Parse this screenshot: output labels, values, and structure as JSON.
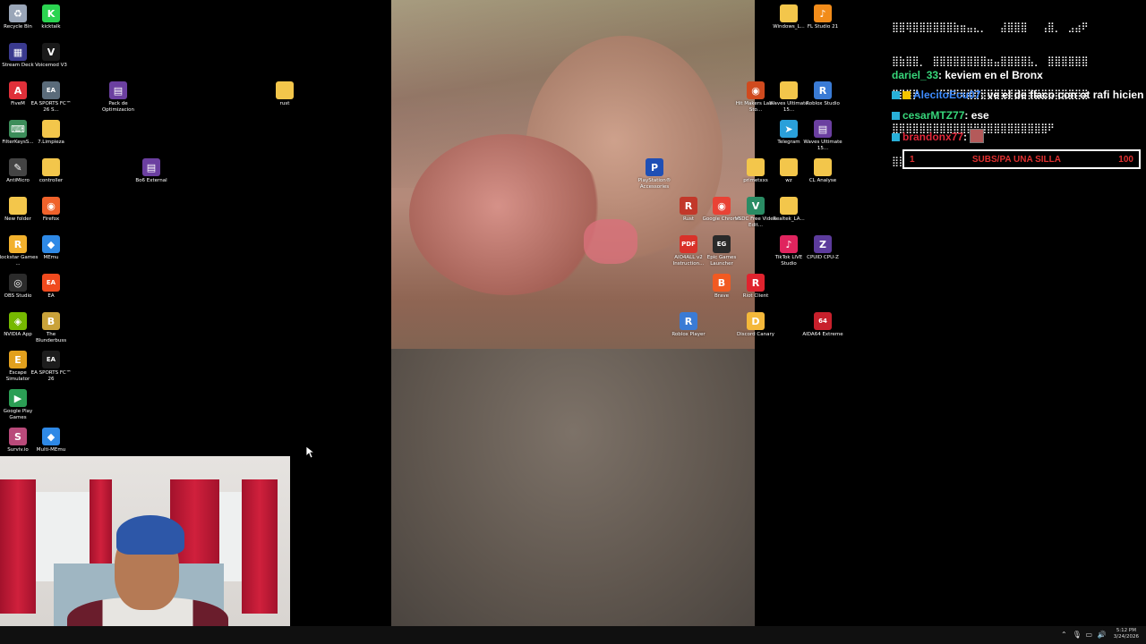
{
  "desktop": {
    "icons": [
      {
        "label": "Recycle Bin",
        "color": "#9aa6b8",
        "glyph": "♻"
      },
      {
        "label": "kicktalk",
        "color": "#2bd451",
        "glyph": "K"
      },
      {
        "label": "Stream Deck",
        "color": "#3a3a8f",
        "glyph": "▦"
      },
      {
        "label": "Voicemod V3",
        "color": "#1a1a1a",
        "glyph": "V"
      },
      {
        "label": "FiveM",
        "color": "#e0303a",
        "glyph": "A"
      },
      {
        "label": "EA SPORTS FC™ 26 S...",
        "color": "#5a6b7a",
        "glyph": "EA"
      },
      {
        "label": "Pack de Optimizacion",
        "color": "#6b3fa0",
        "glyph": "▤"
      },
      {
        "label": "rust",
        "color": "#f3c64b",
        "glyph": ""
      },
      {
        "label": "FilterKeysS...",
        "color": "#3c8d5a",
        "glyph": "⌨"
      },
      {
        "label": "7.Limpieza",
        "color": "#f3c64b",
        "glyph": ""
      },
      {
        "label": "AntiMicro",
        "color": "#444",
        "glyph": "✎"
      },
      {
        "label": "controller",
        "color": "#f3c64b",
        "glyph": ""
      },
      {
        "label": "Bo6 External",
        "color": "#6b3fa0",
        "glyph": "▤"
      },
      {
        "label": "New folder",
        "color": "#f3c64b",
        "glyph": ""
      },
      {
        "label": "Firefox",
        "color": "#f0622b",
        "glyph": "◉"
      },
      {
        "label": "Rockstar Games ...",
        "color": "#f2b12d",
        "glyph": "R"
      },
      {
        "label": "MEmu",
        "color": "#2e89e6",
        "glyph": "◆"
      },
      {
        "label": "OBS Studio",
        "color": "#2b2b2b",
        "glyph": "◎"
      },
      {
        "label": "EA",
        "color": "#f04a1e",
        "glyph": "EA"
      },
      {
        "label": "NVIDIA App",
        "color": "#76b900",
        "glyph": "◈"
      },
      {
        "label": "The Blunderbuss",
        "color": "#c9a23a",
        "glyph": "B"
      },
      {
        "label": "Escape Simulator",
        "color": "#e2a01d",
        "glyph": "E"
      },
      {
        "label": "EA SPORTS FC™ 26",
        "color": "#1d1d1d",
        "glyph": "EA"
      },
      {
        "label": "Google Play Games",
        "color": "#2b9e54",
        "glyph": "▶"
      },
      {
        "label": "Surviv.io",
        "color": "#b94a7a",
        "glyph": "S"
      },
      {
        "label": "Multi-MEmu",
        "color": "#2e89e6",
        "glyph": "◆"
      },
      {
        "label": "Windows_L...",
        "color": "#f3c64b",
        "glyph": ""
      },
      {
        "label": "FL Studio 21",
        "color": "#f28c1a",
        "glyph": "♪"
      },
      {
        "label": "Hit Makers Lab - Sto...",
        "color": "#d04a1e",
        "glyph": "◉"
      },
      {
        "label": "Waves Ultimate 15...",
        "color": "#f3c64b",
        "glyph": ""
      },
      {
        "label": "Roblox Studio",
        "color": "#3a7bd5",
        "glyph": "R"
      },
      {
        "label": "Telegram",
        "color": "#2aa0da",
        "glyph": "➤"
      },
      {
        "label": "Waves Ultimate 15...",
        "color": "#6b3fa0",
        "glyph": "▤"
      },
      {
        "label": "PlayStation® Accessories",
        "color": "#1f4fb5",
        "glyph": "P"
      },
      {
        "label": "primetxxs",
        "color": "#f3c64b",
        "glyph": ""
      },
      {
        "label": "wz",
        "color": "#f3c64b",
        "glyph": ""
      },
      {
        "label": "CL Analyse",
        "color": "#f3c64b",
        "glyph": ""
      },
      {
        "label": "Rust",
        "color": "#c2382a",
        "glyph": "R"
      },
      {
        "label": "Google Chrome",
        "color": "#e94235",
        "glyph": "◉"
      },
      {
        "label": "VSDC Free Video Edit...",
        "color": "#2a8c64",
        "glyph": "V"
      },
      {
        "label": "Realtek_LA...",
        "color": "#f3c64b",
        "glyph": ""
      },
      {
        "label": "AIO4ALL v2 Instruction...",
        "color": "#d9322a",
        "glyph": "PDF"
      },
      {
        "label": "Epic Games Launcher",
        "color": "#2a2a2a",
        "glyph": "EG"
      },
      {
        "label": "TikTok LIVE Studio",
        "color": "#e0245e",
        "glyph": "♪"
      },
      {
        "label": "CPUID CPU-Z",
        "color": "#5c3b9c",
        "glyph": "Z"
      },
      {
        "label": "Brave",
        "color": "#f15a22",
        "glyph": "B"
      },
      {
        "label": "Riot Client",
        "color": "#e0232e",
        "glyph": "R"
      },
      {
        "label": "Roblox Player",
        "color": "#3a7bd5",
        "glyph": "R"
      },
      {
        "label": "Discord Canary",
        "color": "#f4b83a",
        "glyph": "D"
      },
      {
        "label": "AIDA64 Extreme",
        "color": "#c8202c",
        "glyph": "64"
      }
    ]
  },
  "chat": {
    "ascii_lines": [
      "⣿⣿⢿⣿⣿⣿⣿⣿⣿⣷⣶⣤⣄⡀⠀⠀⣼⣿⣿⣿⠀⠀⢠⣿⡀⠀⣠⣴⠟",
      "⣿⣷⣿⣿⡀⠀⣿⣿⣿⣿⣿⣿⣿⣿⣶⣤⣿⣿⣿⣿⣧⡀⠀⣿⣿⣿⣿⣿⣿",
      "⣿⣿⣿⡟⠀⠀⠈⠉⠛⠻⠿⣿⣿⣿⣿⣿⣿⣿⣿⣿⣿⣿⣿⣿⣿⣿⣿⣿⣿",
      "⣿⣿⣿⣿⣿⣿⣿⣿⣿⣿⣿⣿⣿⣿⣿⣿⣿⣿⣿⣿⣿⣿⣿⠟⠀⠀⠀⠀⠀"
    ],
    "messages": [
      {
        "user": "dariel_33",
        "color": "#37d67a",
        "text": ": keviem en el Bronx",
        "badges": []
      },
      {
        "user": "AlecitoEcu07",
        "color": "#3d8bff",
        "text": ": ve el de flaco con ot rafi hicien l",
        "badges": [
          "#29b0d8",
          "#f5c400"
        ]
      },
      {
        "user": "cesarMTZ77",
        "color": "#37d67a",
        "text": ": ese",
        "badges": [
          "#29b0d8"
        ]
      },
      {
        "user": "brandonx77",
        "color": "#e0283a",
        "text": ":",
        "badges": [
          "#29b0d8"
        ]
      }
    ],
    "goal": {
      "left": "1",
      "title": "SUBS/PA UNA SILLA",
      "right": "100"
    }
  },
  "taskbar": {
    "time": "5:12 PM",
    "date": "3/24/2026",
    "tray_icons": [
      "chevron-up-icon",
      "microphone-icon",
      "network-icon",
      "speaker-icon"
    ]
  }
}
